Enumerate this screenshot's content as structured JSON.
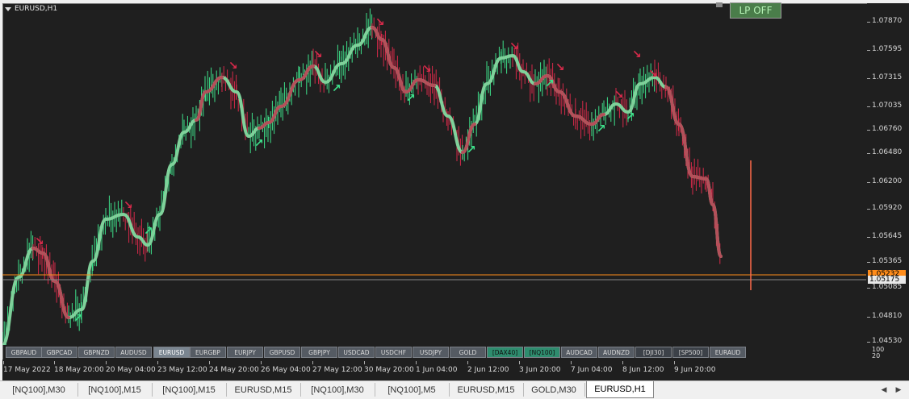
{
  "chart": {
    "title": "EURUSD,H1",
    "lp_button": "LP OFF",
    "colors": {
      "background": "#1f1f1f",
      "bull": "#3ee08a",
      "bear": "#d62a4a",
      "trend_bull": "#7fd19a",
      "trend_bear": "#b4505a",
      "price_line": "#ff8c1a"
    },
    "y_ticks": [
      "1.07870",
      "1.07595",
      "1.07315",
      "1.07035",
      "1.06760",
      "1.06480",
      "1.06200",
      "1.05920",
      "1.05645",
      "1.05365",
      "1.05085",
      "1.04810",
      "1.04530"
    ],
    "price_bid": "1.05232",
    "price_level": "1.05175",
    "x_ticks": [
      "17 May 2022",
      "18 May 20:00",
      "20 May 04:00",
      "23 May 12:00",
      "24 May 20:00",
      "26 May 04:00",
      "27 May 12:00",
      "30 May 20:00",
      "1 Jun 04:00",
      "2 Jun 12:00",
      "3 Jun 20:00",
      "7 Jun 04:00",
      "8 Jun 12:00",
      "9 Jun 20:00"
    ],
    "indicator_levels": [
      "100",
      "20"
    ]
  },
  "symbols": [
    {
      "label": "GBPAUD",
      "style": "normal"
    },
    {
      "label": "GBPCAD",
      "style": "normal"
    },
    {
      "label": "GBPNZD",
      "style": "normal"
    },
    {
      "label": "AUDUSD",
      "style": "normal"
    },
    {
      "label": "EURUSD",
      "style": "active"
    },
    {
      "label": "EURGBP",
      "style": "normal"
    },
    {
      "label": "EURJPY",
      "style": "normal"
    },
    {
      "label": "GBPUSD",
      "style": "normal"
    },
    {
      "label": "GBPJPY",
      "style": "normal"
    },
    {
      "label": "USDCAD",
      "style": "normal"
    },
    {
      "label": "USDCHF",
      "style": "normal"
    },
    {
      "label": "USDJPY",
      "style": "normal"
    },
    {
      "label": "GOLD",
      "style": "normal"
    },
    {
      "label": "[DAX40]",
      "style": "green"
    },
    {
      "label": "[NQ100]",
      "style": "green"
    },
    {
      "label": "AUDCAD",
      "style": "normal"
    },
    {
      "label": "AUDNZD",
      "style": "normal"
    },
    {
      "label": "[DJI30]",
      "style": "grey"
    },
    {
      "label": "[SP500]",
      "style": "grey"
    },
    {
      "label": "EURAUD",
      "style": "normal"
    }
  ],
  "tabs": [
    {
      "label": "[NQ100],M30",
      "active": false
    },
    {
      "label": "[NQ100],M15",
      "active": false
    },
    {
      "label": "[NQ100],M15",
      "active": false
    },
    {
      "label": "EURUSD,M15",
      "active": false
    },
    {
      "label": "[NQ100],M30",
      "active": false
    },
    {
      "label": "[NQ100],M5",
      "active": false
    },
    {
      "label": "EURUSD,M15",
      "active": false
    },
    {
      "label": "GOLD,M30",
      "active": false
    },
    {
      "label": "EURUSD,H1",
      "active": true
    }
  ],
  "scroll": {
    "left_icon": "triangle-left-icon",
    "right_icon": "triangle-right-icon"
  }
}
